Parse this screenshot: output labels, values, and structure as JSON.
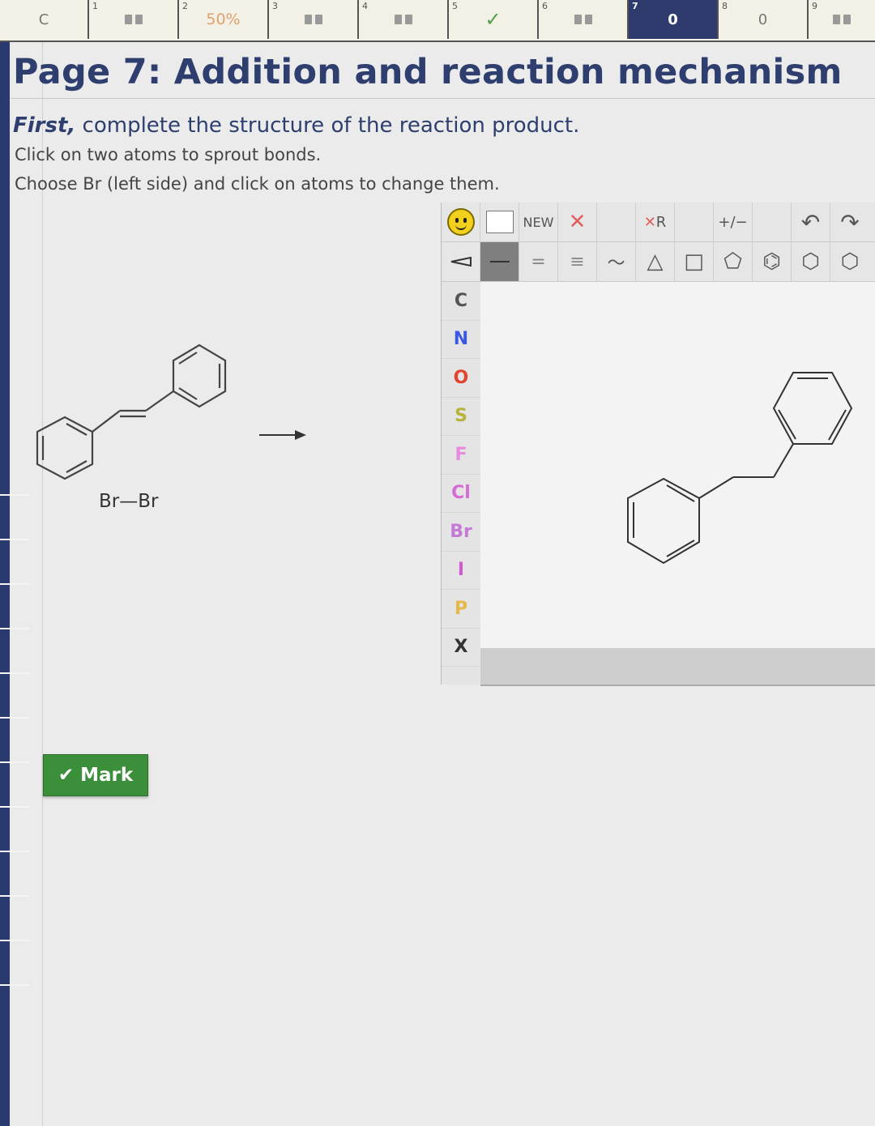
{
  "topbar": {
    "cells": [
      {
        "num": "",
        "value": "C",
        "kind": "text"
      },
      {
        "num": "1",
        "value": "",
        "kind": "book"
      },
      {
        "num": "2",
        "value": "50%",
        "kind": "pct"
      },
      {
        "num": "3",
        "value": "",
        "kind": "book"
      },
      {
        "num": "4",
        "value": "",
        "kind": "book"
      },
      {
        "num": "5",
        "value": "",
        "kind": "check"
      },
      {
        "num": "6",
        "value": "",
        "kind": "book"
      },
      {
        "num": "7",
        "value": "0",
        "kind": "current"
      },
      {
        "num": "8",
        "value": "0",
        "kind": "text"
      },
      {
        "num": "9",
        "value": "",
        "kind": "book"
      }
    ]
  },
  "header": {
    "title": "Page 7: Addition and reaction mechanism",
    "instr_lead": "First,",
    "instr_main": " complete the structure of the reaction product.",
    "instr2": "Click on two atoms to sprout bonds.",
    "instr3": "Choose Br (left side) and click on atoms to change them."
  },
  "reaction": {
    "reagent": "Br—Br"
  },
  "editor": {
    "new_label": "NEW",
    "rgroup_label": "R",
    "charge_label": "+/−",
    "atoms": [
      {
        "symbol": "C",
        "color": "#555555"
      },
      {
        "symbol": "N",
        "color": "#3a58e0"
      },
      {
        "symbol": "O",
        "color": "#e0442e"
      },
      {
        "symbol": "S",
        "color": "#b7b23a"
      },
      {
        "symbol": "F",
        "color": "#e88ae0"
      },
      {
        "symbol": "Cl",
        "color": "#d66ad6"
      },
      {
        "symbol": "Br",
        "color": "#c47ad6"
      },
      {
        "symbol": "I",
        "color": "#d05ad0"
      },
      {
        "symbol": "P",
        "color": "#e6b84a"
      },
      {
        "symbol": "X",
        "color": "#333333"
      }
    ]
  },
  "mark_button": {
    "label": "Mark",
    "color": "#3c8f3a"
  }
}
